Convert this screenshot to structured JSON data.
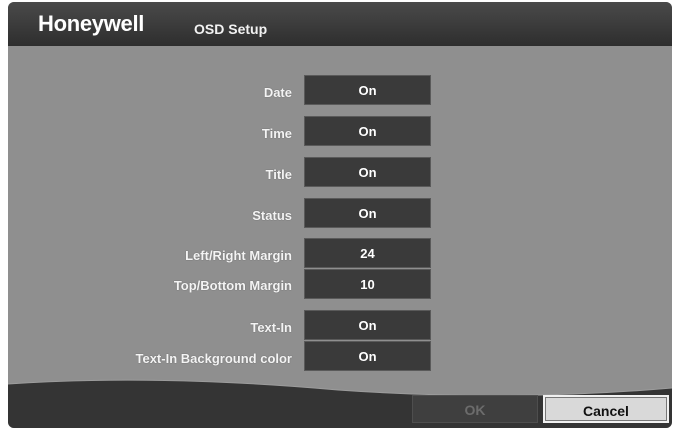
{
  "header": {
    "brand": "Honeywell",
    "title": "OSD Setup"
  },
  "settings": [
    {
      "label": "Date",
      "value": "On"
    },
    {
      "label": "Time",
      "value": "On"
    },
    {
      "label": "Title",
      "value": "On"
    },
    {
      "label": "Status",
      "value": "On"
    },
    {
      "label": "Left/Right Margin",
      "value": "24"
    },
    {
      "label": "Top/Bottom Margin",
      "value": "10"
    },
    {
      "label": "Text-In",
      "value": "On"
    },
    {
      "label": "Text-In Background color",
      "value": "On"
    }
  ],
  "buttons": {
    "ok": "OK",
    "cancel": "Cancel"
  }
}
